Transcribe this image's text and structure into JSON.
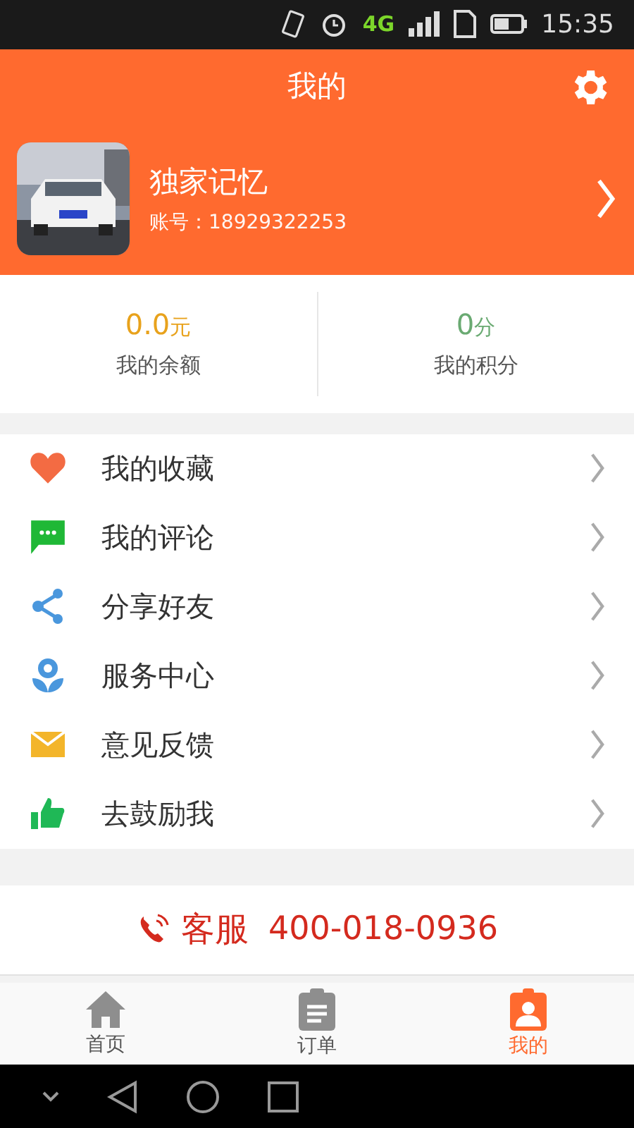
{
  "status_bar": {
    "network": "4G",
    "time": "15:35"
  },
  "header": {
    "title": "我的"
  },
  "profile": {
    "name": "独家记忆",
    "account_label": "账号：",
    "account": "18929322253"
  },
  "stats": [
    {
      "value": "0.0",
      "unit": "元",
      "label": "我的余额",
      "color": "#e8a21c"
    },
    {
      "value": "0",
      "unit": "分",
      "label": "我的积分",
      "color": "#6aaa72"
    }
  ],
  "menu": [
    {
      "label": "我的收藏"
    },
    {
      "label": "我的评论"
    },
    {
      "label": "分享好友"
    },
    {
      "label": "服务中心"
    },
    {
      "label": "意见反馈"
    },
    {
      "label": "去鼓励我"
    }
  ],
  "service": {
    "label": "客服",
    "phone": "400-018-0936"
  },
  "tabs": [
    {
      "label": "首页",
      "selected": false
    },
    {
      "label": "订单",
      "selected": false
    },
    {
      "label": "我的",
      "selected": true
    }
  ]
}
